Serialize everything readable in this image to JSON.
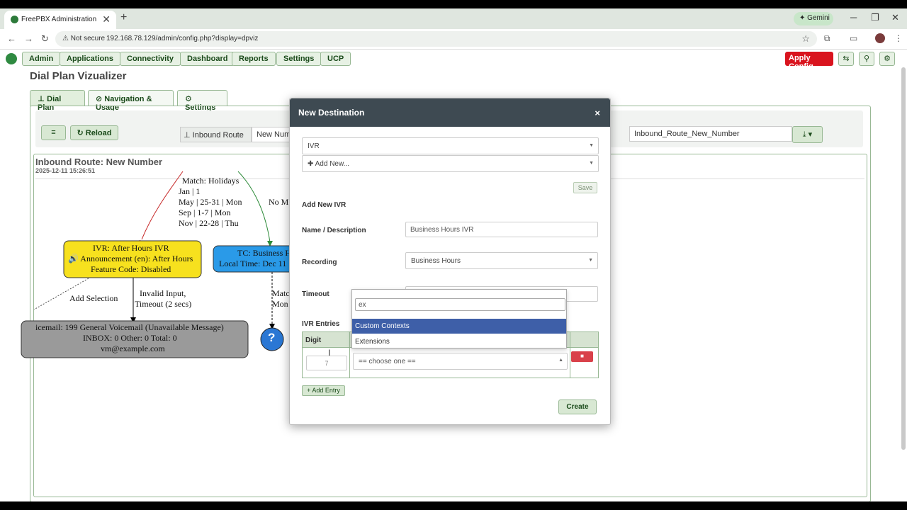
{
  "browser": {
    "tab_title": "FreePBX Administration",
    "tab_close": "✕",
    "new_tab": "+",
    "gemini_label": "Gemini",
    "not_secure": "Not secure",
    "url": "192.168.78.129/admin/config.php?display=dpviz"
  },
  "pbx_nav": {
    "items": [
      "Admin",
      "Applications",
      "Connectivity",
      "Dashboard",
      "Reports",
      "Settings",
      "UCP"
    ],
    "apply_label": "Apply Config"
  },
  "page": {
    "title": "Dial Plan Vizualizer",
    "tabs": [
      "Dial Plan",
      "Navigation & Usage",
      "Settings"
    ],
    "reload_label": "Reload",
    "route_type_label": "Inbound Route",
    "route_name_value": "New Numb",
    "route_id_value": "Inbound_Route_New_Number",
    "route_title": "Inbound Route: New Number",
    "route_date": "2025-12-11 15:26:51"
  },
  "graph": {
    "match_holidays": [
      "Match: Holidays",
      "Jan | 1",
      "May | 25-31 | Mon",
      "Sep | 1-7 | Mon",
      "Nov | 22-28 | Thu"
    ],
    "no_match": "No M",
    "ivr_node": [
      "IVR: After Hours IVR",
      "Announcement (en): After Hours",
      "Feature Code: Disabled"
    ],
    "tc_node": [
      "TC: Business H",
      "Local Time: Dec 11"
    ],
    "add_selection": "Add Selection",
    "invalid_input": [
      "Invalid Input,",
      "Timeout (2 secs)"
    ],
    "matc": [
      "Matc",
      "Mon"
    ],
    "vm_node": [
      "icemail: 199 General Voicemail (Unavailable Message)",
      "INBOX: 0  Other: 0  Total: 0",
      "vm@example.com"
    ],
    "question": "?"
  },
  "modal": {
    "title": "New Destination",
    "close": "×",
    "dest_type": "IVR",
    "add_new": "Add New...",
    "save_label": "Save",
    "section_title": "Add New IVR",
    "name_label": "Name / Description",
    "name_value": "Business Hours IVR",
    "recording_label": "Recording",
    "recording_value": "Business Hours",
    "timeout_label": "Timeout",
    "entries_label": "IVR Entries",
    "digit_header": "Digit",
    "digit_value": "7",
    "choose_value": "== choose one ==",
    "add_entry_label": "+ Add Entry",
    "create_label": "Create"
  },
  "dropdown": {
    "search_value": "ex",
    "options": [
      "Custom Contexts",
      "Extensions"
    ]
  },
  "colors": {
    "ivr_node_fill": "#f7e11e",
    "tc_node_fill": "#2a9ae8",
    "vm_node_fill": "#9a9a9a",
    "question_fill": "#2a77d4",
    "apply_red": "#d9141e",
    "modal_header": "#3e4a52",
    "highlight": "#3e5fa8"
  }
}
